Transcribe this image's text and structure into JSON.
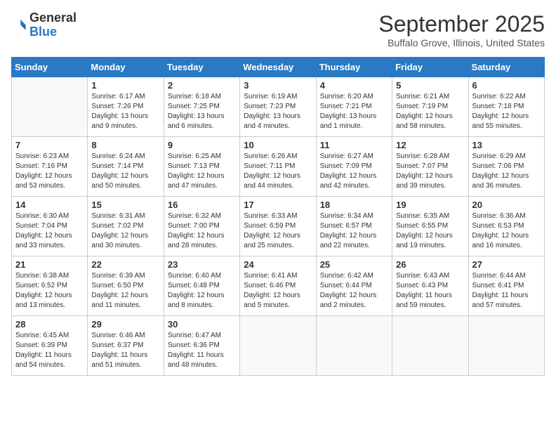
{
  "app": {
    "logo_general": "General",
    "logo_blue": "Blue"
  },
  "header": {
    "month": "September 2025",
    "location": "Buffalo Grove, Illinois, United States"
  },
  "weekdays": [
    "Sunday",
    "Monday",
    "Tuesday",
    "Wednesday",
    "Thursday",
    "Friday",
    "Saturday"
  ],
  "weeks": [
    [
      {
        "day": "",
        "sunrise": "",
        "sunset": "",
        "daylight": ""
      },
      {
        "day": "1",
        "sunrise": "Sunrise: 6:17 AM",
        "sunset": "Sunset: 7:26 PM",
        "daylight": "Daylight: 13 hours and 9 minutes."
      },
      {
        "day": "2",
        "sunrise": "Sunrise: 6:18 AM",
        "sunset": "Sunset: 7:25 PM",
        "daylight": "Daylight: 13 hours and 6 minutes."
      },
      {
        "day": "3",
        "sunrise": "Sunrise: 6:19 AM",
        "sunset": "Sunset: 7:23 PM",
        "daylight": "Daylight: 13 hours and 4 minutes."
      },
      {
        "day": "4",
        "sunrise": "Sunrise: 6:20 AM",
        "sunset": "Sunset: 7:21 PM",
        "daylight": "Daylight: 13 hours and 1 minute."
      },
      {
        "day": "5",
        "sunrise": "Sunrise: 6:21 AM",
        "sunset": "Sunset: 7:19 PM",
        "daylight": "Daylight: 12 hours and 58 minutes."
      },
      {
        "day": "6",
        "sunrise": "Sunrise: 6:22 AM",
        "sunset": "Sunset: 7:18 PM",
        "daylight": "Daylight: 12 hours and 55 minutes."
      }
    ],
    [
      {
        "day": "7",
        "sunrise": "Sunrise: 6:23 AM",
        "sunset": "Sunset: 7:16 PM",
        "daylight": "Daylight: 12 hours and 53 minutes."
      },
      {
        "day": "8",
        "sunrise": "Sunrise: 6:24 AM",
        "sunset": "Sunset: 7:14 PM",
        "daylight": "Daylight: 12 hours and 50 minutes."
      },
      {
        "day": "9",
        "sunrise": "Sunrise: 6:25 AM",
        "sunset": "Sunset: 7:13 PM",
        "daylight": "Daylight: 12 hours and 47 minutes."
      },
      {
        "day": "10",
        "sunrise": "Sunrise: 6:26 AM",
        "sunset": "Sunset: 7:11 PM",
        "daylight": "Daylight: 12 hours and 44 minutes."
      },
      {
        "day": "11",
        "sunrise": "Sunrise: 6:27 AM",
        "sunset": "Sunset: 7:09 PM",
        "daylight": "Daylight: 12 hours and 42 minutes."
      },
      {
        "day": "12",
        "sunrise": "Sunrise: 6:28 AM",
        "sunset": "Sunset: 7:07 PM",
        "daylight": "Daylight: 12 hours and 39 minutes."
      },
      {
        "day": "13",
        "sunrise": "Sunrise: 6:29 AM",
        "sunset": "Sunset: 7:06 PM",
        "daylight": "Daylight: 12 hours and 36 minutes."
      }
    ],
    [
      {
        "day": "14",
        "sunrise": "Sunrise: 6:30 AM",
        "sunset": "Sunset: 7:04 PM",
        "daylight": "Daylight: 12 hours and 33 minutes."
      },
      {
        "day": "15",
        "sunrise": "Sunrise: 6:31 AM",
        "sunset": "Sunset: 7:02 PM",
        "daylight": "Daylight: 12 hours and 30 minutes."
      },
      {
        "day": "16",
        "sunrise": "Sunrise: 6:32 AM",
        "sunset": "Sunset: 7:00 PM",
        "daylight": "Daylight: 12 hours and 28 minutes."
      },
      {
        "day": "17",
        "sunrise": "Sunrise: 6:33 AM",
        "sunset": "Sunset: 6:59 PM",
        "daylight": "Daylight: 12 hours and 25 minutes."
      },
      {
        "day": "18",
        "sunrise": "Sunrise: 6:34 AM",
        "sunset": "Sunset: 6:57 PM",
        "daylight": "Daylight: 12 hours and 22 minutes."
      },
      {
        "day": "19",
        "sunrise": "Sunrise: 6:35 AM",
        "sunset": "Sunset: 6:55 PM",
        "daylight": "Daylight: 12 hours and 19 minutes."
      },
      {
        "day": "20",
        "sunrise": "Sunrise: 6:36 AM",
        "sunset": "Sunset: 6:53 PM",
        "daylight": "Daylight: 12 hours and 16 minutes."
      }
    ],
    [
      {
        "day": "21",
        "sunrise": "Sunrise: 6:38 AM",
        "sunset": "Sunset: 6:52 PM",
        "daylight": "Daylight: 12 hours and 13 minutes."
      },
      {
        "day": "22",
        "sunrise": "Sunrise: 6:39 AM",
        "sunset": "Sunset: 6:50 PM",
        "daylight": "Daylight: 12 hours and 11 minutes."
      },
      {
        "day": "23",
        "sunrise": "Sunrise: 6:40 AM",
        "sunset": "Sunset: 6:48 PM",
        "daylight": "Daylight: 12 hours and 8 minutes."
      },
      {
        "day": "24",
        "sunrise": "Sunrise: 6:41 AM",
        "sunset": "Sunset: 6:46 PM",
        "daylight": "Daylight: 12 hours and 5 minutes."
      },
      {
        "day": "25",
        "sunrise": "Sunrise: 6:42 AM",
        "sunset": "Sunset: 6:44 PM",
        "daylight": "Daylight: 12 hours and 2 minutes."
      },
      {
        "day": "26",
        "sunrise": "Sunrise: 6:43 AM",
        "sunset": "Sunset: 6:43 PM",
        "daylight": "Daylight: 11 hours and 59 minutes."
      },
      {
        "day": "27",
        "sunrise": "Sunrise: 6:44 AM",
        "sunset": "Sunset: 6:41 PM",
        "daylight": "Daylight: 11 hours and 57 minutes."
      }
    ],
    [
      {
        "day": "28",
        "sunrise": "Sunrise: 6:45 AM",
        "sunset": "Sunset: 6:39 PM",
        "daylight": "Daylight: 11 hours and 54 minutes."
      },
      {
        "day": "29",
        "sunrise": "Sunrise: 6:46 AM",
        "sunset": "Sunset: 6:37 PM",
        "daylight": "Daylight: 11 hours and 51 minutes."
      },
      {
        "day": "30",
        "sunrise": "Sunrise: 6:47 AM",
        "sunset": "Sunset: 6:36 PM",
        "daylight": "Daylight: 11 hours and 48 minutes."
      },
      {
        "day": "",
        "sunrise": "",
        "sunset": "",
        "daylight": ""
      },
      {
        "day": "",
        "sunrise": "",
        "sunset": "",
        "daylight": ""
      },
      {
        "day": "",
        "sunrise": "",
        "sunset": "",
        "daylight": ""
      },
      {
        "day": "",
        "sunrise": "",
        "sunset": "",
        "daylight": ""
      }
    ]
  ]
}
